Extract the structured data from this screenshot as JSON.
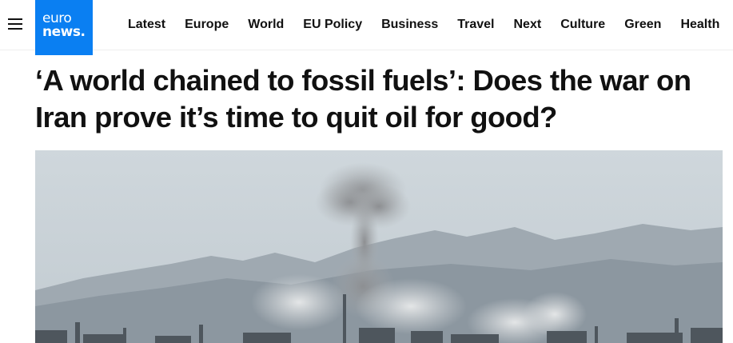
{
  "header": {
    "logo": {
      "line1": "euro",
      "line2": "news."
    },
    "menu_icon": "hamburger-icon",
    "nav": [
      "Latest",
      "Europe",
      "World",
      "EU Policy",
      "Business",
      "Travel",
      "Next",
      "Culture",
      "Green",
      "Health"
    ]
  },
  "article": {
    "headline": "‘A world chained to fossil fuels’: Does the war on Iran prove it’s time to quit oil for good?",
    "image": {
      "description_icon": "smoke-over-city-photo"
    }
  },
  "colors": {
    "brand_blue": "#0a7ff2",
    "text": "#111111"
  }
}
